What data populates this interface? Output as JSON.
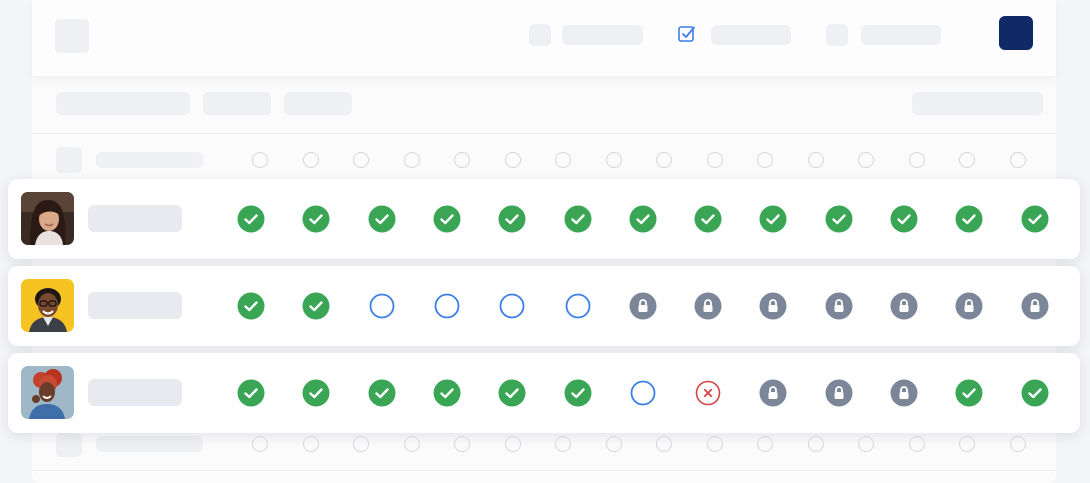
{
  "colors": {
    "accent_navy": "#0f2a66",
    "complete_green": "#3aa655",
    "pending_blue": "#3b7ee8",
    "locked_gray": "#7c8699",
    "failed_red": "#d64545"
  },
  "toolbar": {
    "checklist_icon": "check-square-icon",
    "primary_button_color": "#0f2a66"
  },
  "ghost_header_row": {
    "circles": 16
  },
  "ghost_footer_row": {
    "circles": 16
  },
  "users": [
    {
      "avatar": "avatar-woman-brown-hair",
      "statuses": [
        "complete",
        "complete",
        "complete",
        "complete",
        "complete",
        "complete",
        "complete",
        "complete",
        "complete",
        "complete",
        "complete",
        "complete",
        "complete"
      ]
    },
    {
      "avatar": "avatar-man-yellow-background",
      "statuses": [
        "complete",
        "complete",
        "pending",
        "pending",
        "pending",
        "pending",
        "locked",
        "locked",
        "locked",
        "locked",
        "locked",
        "locked",
        "locked"
      ]
    },
    {
      "avatar": "avatar-woman-red-curly-hair",
      "statuses": [
        "complete",
        "complete",
        "complete",
        "complete",
        "complete",
        "complete",
        "pending",
        "failed",
        "locked",
        "locked",
        "locked",
        "complete",
        "complete"
      ]
    }
  ]
}
